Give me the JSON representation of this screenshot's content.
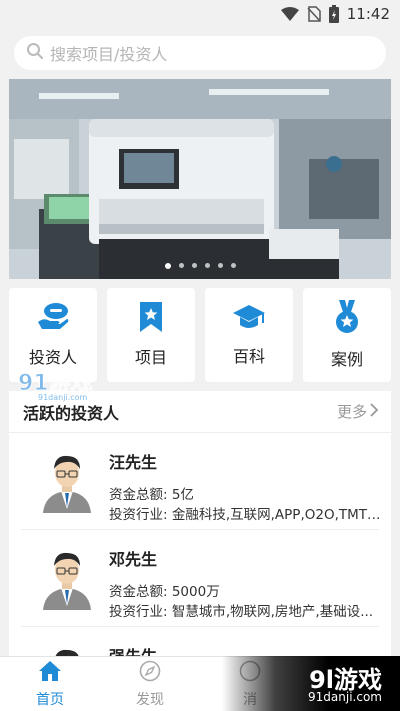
{
  "status_bar": {
    "time": "11:42"
  },
  "search": {
    "placeholder": "搜索项目/投资人"
  },
  "banner": {
    "slide_count": 6,
    "active_index": 0
  },
  "categories": [
    {
      "label": "投资人",
      "icon": "investor-icon"
    },
    {
      "label": "项目",
      "icon": "bookmark-star-icon"
    },
    {
      "label": "百科",
      "icon": "graduation-cap-icon"
    },
    {
      "label": "案例",
      "icon": "medal-icon"
    }
  ],
  "active_investors": {
    "title": "活跃的投资人",
    "more_label": "更多",
    "items": [
      {
        "name": "汪先生",
        "funds": "资金总额: 5亿",
        "industry": "投资行业: 金融科技,互联网,APP,O2O,TMT,生..."
      },
      {
        "name": "邓先生",
        "funds": "资金总额: 5000万",
        "industry": "投资行业: 智慧城市,物联网,房地产,基础设..."
      },
      {
        "name": "强先生",
        "funds": "",
        "industry": ""
      }
    ]
  },
  "tabbar": {
    "tabs": [
      {
        "label": "首页",
        "icon": "home-icon"
      },
      {
        "label": "发现",
        "icon": "compass-icon"
      },
      {
        "label": "消",
        "icon": "message-icon"
      }
    ]
  },
  "watermark": {
    "logo_text": "91游戏",
    "site": "91danji.com",
    "corner_text": "9l游戏",
    "corner_site": "91danji.com"
  },
  "colors": {
    "accent": "#1f8bd6",
    "background": "#f1f1f1"
  }
}
